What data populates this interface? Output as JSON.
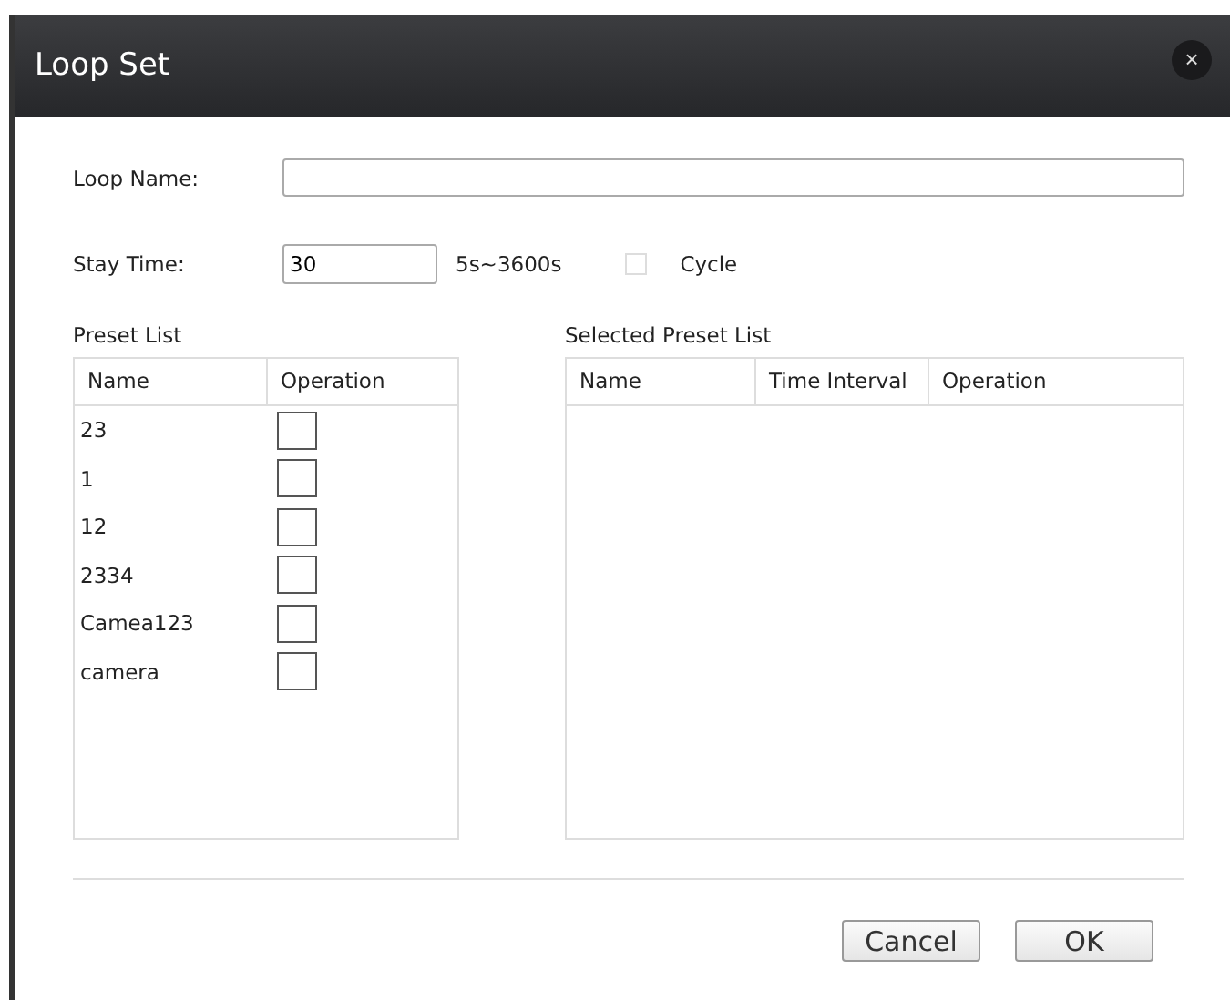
{
  "window": {
    "title": "Loop Set",
    "close": "×"
  },
  "loop_name": {
    "label": "Loop Name:"
  },
  "stay_time": {
    "label": "Stay Time:",
    "value": "30",
    "range": "5s~3600s"
  },
  "cycle": {
    "label": "Cycle",
    "checked": false
  },
  "preset_list": {
    "title": "Preset List",
    "columns": [
      "Name",
      "Operation"
    ],
    "rows": [
      {
        "name": "23",
        "checked": false
      },
      {
        "name": "1",
        "checked": false
      },
      {
        "name": "12",
        "checked": false
      },
      {
        "name": "2334",
        "checked": false
      },
      {
        "name": "Camea123",
        "checked": false
      },
      {
        "name": "camera",
        "checked": false
      }
    ]
  },
  "selected_preset_list": {
    "title": "Selected Preset List",
    "columns": [
      "Name",
      "Time Interval",
      "Operation"
    ]
  },
  "buttons": [
    "Cancel",
    "OK"
  ]
}
